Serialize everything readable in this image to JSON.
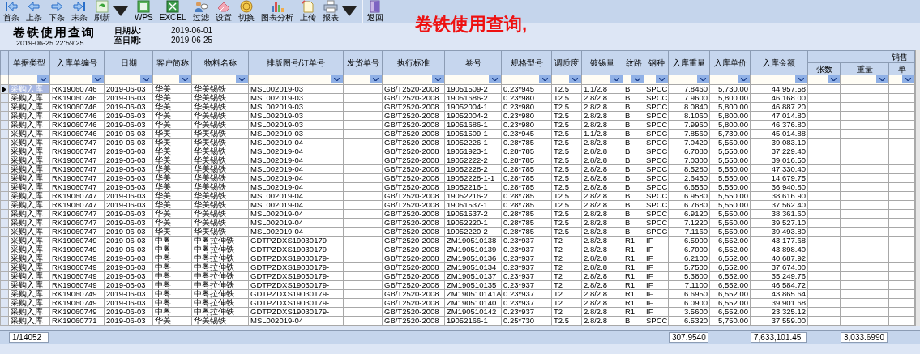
{
  "toolbar": [
    {
      "label": "首条",
      "dropdown": false,
      "separator_before": false
    },
    {
      "label": "上条",
      "dropdown": false,
      "separator_before": false
    },
    {
      "label": "下条",
      "dropdown": false,
      "separator_before": false
    },
    {
      "label": "末条",
      "dropdown": false,
      "separator_before": false
    },
    {
      "label": "刷新",
      "dropdown": true,
      "separator_before": false
    },
    {
      "label": "WPS",
      "dropdown": false,
      "separator_before": false
    },
    {
      "label": "EXCEL",
      "dropdown": false,
      "separator_before": false
    },
    {
      "label": "过滤",
      "dropdown": false,
      "separator_before": false
    },
    {
      "label": "设置",
      "dropdown": false,
      "separator_before": false
    },
    {
      "label": "切换",
      "dropdown": false,
      "separator_before": false
    },
    {
      "label": "图表分析",
      "dropdown": false,
      "separator_before": false
    },
    {
      "label": "上传",
      "dropdown": false,
      "separator_before": false
    },
    {
      "label": "报表",
      "dropdown": true,
      "separator_before": false
    },
    {
      "label": "返回",
      "dropdown": false,
      "separator_before": true
    }
  ],
  "overlay_annotation": "卷铁使用查询,",
  "header": {
    "title": "卷铁使用查询",
    "timestamp": "2019-06-25 22:59:25",
    "date_from_label": "日期从:",
    "date_from": "2019-06-01",
    "date_to_label": "至日期:",
    "date_to": "2019-06-25"
  },
  "table": {
    "columns": [
      "单据类型",
      "入库单编号",
      "日期",
      "客户简称",
      "物料名称",
      "排版图号/订单号",
      "发货单号",
      "执行标准",
      "卷号",
      "规格型号",
      "调质度",
      "镀锡量",
      "纹路",
      "钢种",
      "入库重量",
      "入库单价",
      "入库金额"
    ],
    "column_groups": [
      {
        "label": "销售",
        "columns": [
          "张数",
          "重量",
          "单"
        ]
      }
    ],
    "rows": [
      {
        "selected": true,
        "cells": [
          "采购入库",
          "RK19060746",
          "2019-06-03",
          "华美",
          "华美锡铁",
          "MSL002019-03",
          "",
          "GB/T2520-2008",
          "19051509-2",
          "0.23*945",
          "T2.5",
          "1.1/2.8",
          "B",
          "SPCC",
          "7.8460",
          "5,730.00",
          "44,957.58"
        ]
      },
      {
        "selected": false,
        "cells": [
          "采购入库",
          "RK19060746",
          "2019-06-03",
          "华美",
          "华美锡铁",
          "MSL002019-03",
          "",
          "GB/T2520-2008",
          "19051686-2",
          "0.23*980",
          "T2.5",
          "2.8/2.8",
          "B",
          "SPCC",
          "7.9600",
          "5,800.00",
          "46,168.00"
        ]
      },
      {
        "selected": false,
        "cells": [
          "采购入库",
          "RK19060746",
          "2019-06-03",
          "华美",
          "华美锡铁",
          "MSL002019-03",
          "",
          "GB/T2520-2008",
          "19052004-1",
          "0.23*980",
          "T2.5",
          "2.8/2.8",
          "B",
          "SPCC",
          "8.0840",
          "5,800.00",
          "46,887.20"
        ]
      },
      {
        "selected": false,
        "cells": [
          "采购入库",
          "RK19060746",
          "2019-06-03",
          "华美",
          "华美锡铁",
          "MSL002019-03",
          "",
          "GB/T2520-2008",
          "19052004-2",
          "0.23*980",
          "T2.5",
          "2.8/2.8",
          "B",
          "SPCC",
          "8.1060",
          "5,800.00",
          "47,014.80"
        ]
      },
      {
        "selected": false,
        "cells": [
          "采购入库",
          "RK19060746",
          "2019-06-03",
          "华美",
          "华美锡铁",
          "MSL002019-03",
          "",
          "GB/T2520-2008",
          "19051686-1",
          "0.23*980",
          "T2.5",
          "2.8/2.8",
          "B",
          "SPCC",
          "7.9960",
          "5,800.00",
          "46,376.80"
        ]
      },
      {
        "selected": false,
        "cells": [
          "采购入库",
          "RK19060746",
          "2019-06-03",
          "华美",
          "华美锡铁",
          "MSL002019-03",
          "",
          "GB/T2520-2008",
          "19051509-1",
          "0.23*945",
          "T2.5",
          "1.1/2.8",
          "B",
          "SPCC",
          "7.8560",
          "5,730.00",
          "45,014.88"
        ]
      },
      {
        "selected": false,
        "cells": [
          "采购入库",
          "RK19060747",
          "2019-06-03",
          "华美",
          "华美锡铁",
          "MSL002019-04",
          "",
          "GB/T2520-2008",
          "19052226-1",
          "0.28*785",
          "T2.5",
          "2.8/2.8",
          "B",
          "SPCC",
          "7.0420",
          "5,550.00",
          "39,083.10"
        ]
      },
      {
        "selected": false,
        "cells": [
          "采购入库",
          "RK19060747",
          "2019-06-03",
          "华美",
          "华美锡铁",
          "MSL002019-04",
          "",
          "GB/T2520-2008",
          "19051923-1",
          "0.28*785",
          "T2.5",
          "2.8/2.8",
          "B",
          "SPCC",
          "6.7080",
          "5,550.00",
          "37,229.40"
        ]
      },
      {
        "selected": false,
        "cells": [
          "采购入库",
          "RK19060747",
          "2019-06-03",
          "华美",
          "华美锡铁",
          "MSL002019-04",
          "",
          "GB/T2520-2008",
          "19052222-2",
          "0.28*785",
          "T2.5",
          "2.8/2.8",
          "B",
          "SPCC",
          "7.0300",
          "5,550.00",
          "39,016.50"
        ]
      },
      {
        "selected": false,
        "cells": [
          "采购入库",
          "RK19060747",
          "2019-06-03",
          "华美",
          "华美锡铁",
          "MSL002019-04",
          "",
          "GB/T2520-2008",
          "19052228-2",
          "0.28*785",
          "T2.5",
          "2.8/2.8",
          "B",
          "SPCC",
          "8.5280",
          "5,550.00",
          "47,330.40"
        ]
      },
      {
        "selected": false,
        "cells": [
          "采购入库",
          "RK19060747",
          "2019-06-03",
          "华美",
          "华美锡铁",
          "MSL002019-04",
          "",
          "GB/T2520-2008",
          "19052228-1-1",
          "0.28*785",
          "T2.5",
          "2.8/2.8",
          "B",
          "SPCC",
          "2.6450",
          "5,550.00",
          "14,679.75"
        ]
      },
      {
        "selected": false,
        "cells": [
          "采购入库",
          "RK19060747",
          "2019-06-03",
          "华美",
          "华美锡铁",
          "MSL002019-04",
          "",
          "GB/T2520-2008",
          "19052216-1",
          "0.28*785",
          "T2.5",
          "2.8/2.8",
          "B",
          "SPCC",
          "6.6560",
          "5,550.00",
          "36,940.80"
        ]
      },
      {
        "selected": false,
        "cells": [
          "采购入库",
          "RK19060747",
          "2019-06-03",
          "华美",
          "华美锡铁",
          "MSL002019-04",
          "",
          "GB/T2520-2008",
          "19052216-2",
          "0.28*785",
          "T2.5",
          "2.8/2.8",
          "B",
          "SPCC",
          "6.9580",
          "5,550.00",
          "38,616.90"
        ]
      },
      {
        "selected": false,
        "cells": [
          "采购入库",
          "RK19060747",
          "2019-06-03",
          "华美",
          "华美锡铁",
          "MSL002019-04",
          "",
          "GB/T2520-2008",
          "19051537-1",
          "0.28*785",
          "T2.5",
          "2.8/2.8",
          "B",
          "SPCC",
          "6.7680",
          "5,550.00",
          "37,562.40"
        ]
      },
      {
        "selected": false,
        "cells": [
          "采购入库",
          "RK19060747",
          "2019-06-03",
          "华美",
          "华美锡铁",
          "MSL002019-04",
          "",
          "GB/T2520-2008",
          "19051537-2",
          "0.28*785",
          "T2.5",
          "2.8/2.8",
          "B",
          "SPCC",
          "6.9120",
          "5,550.00",
          "38,361.60"
        ]
      },
      {
        "selected": false,
        "cells": [
          "采购入库",
          "RK19060747",
          "2019-06-03",
          "华美",
          "华美锡铁",
          "MSL002019-04",
          "",
          "GB/T2520-2008",
          "19052220-1",
          "0.28*785",
          "T2.5",
          "2.8/2.8",
          "B",
          "SPCC",
          "7.1220",
          "5,550.00",
          "39,527.10"
        ]
      },
      {
        "selected": false,
        "cells": [
          "采购入库",
          "RK19060747",
          "2019-06-03",
          "华美",
          "华美锡铁",
          "MSL002019-04",
          "",
          "GB/T2520-2008",
          "19052220-2",
          "0.28*785",
          "T2.5",
          "2.8/2.8",
          "B",
          "SPCC",
          "7.1160",
          "5,550.00",
          "39,493.80"
        ]
      },
      {
        "selected": false,
        "cells": [
          "采购入库",
          "RK19060749",
          "2019-06-03",
          "中粤",
          "中粤拉伸铁",
          "GDTPZDXS19030179-",
          "",
          "GB/T2520-2008",
          "ZM190510138",
          "0.23*937",
          "T2",
          "2.8/2.8",
          "R1",
          "IF",
          "6.5900",
          "6,552.00",
          "43,177.68"
        ]
      },
      {
        "selected": false,
        "cells": [
          "采购入库",
          "RK19060749",
          "2019-06-03",
          "中粤",
          "中粤拉伸铁",
          "GDTPZDXS19030179-",
          "",
          "GB/T2520-2008",
          "ZM190510139",
          "0.23*937",
          "T2",
          "2.8/2.8",
          "R1",
          "IF",
          "6.7000",
          "6,552.00",
          "43,898.40"
        ]
      },
      {
        "selected": false,
        "cells": [
          "采购入库",
          "RK19060749",
          "2019-06-03",
          "中粤",
          "中粤拉伸铁",
          "GDTPZDXS19030179-",
          "",
          "GB/T2520-2008",
          "ZM190510136",
          "0.23*937",
          "T2",
          "2.8/2.8",
          "R1",
          "IF",
          "6.2100",
          "6,552.00",
          "40,687.92"
        ]
      },
      {
        "selected": false,
        "cells": [
          "采购入库",
          "RK19060749",
          "2019-06-03",
          "中粤",
          "中粤拉伸铁",
          "GDTPZDXS19030179-",
          "",
          "GB/T2520-2008",
          "ZM190510134",
          "0.23*937",
          "T2",
          "2.8/2.8",
          "R1",
          "IF",
          "5.7500",
          "6,552.00",
          "37,674.00"
        ]
      },
      {
        "selected": false,
        "cells": [
          "采购入库",
          "RK19060749",
          "2019-06-03",
          "中粤",
          "中粤拉伸铁",
          "GDTPZDXS19030179-",
          "",
          "GB/T2520-2008",
          "ZM190510137",
          "0.23*937",
          "T2",
          "2.8/2.8",
          "R1",
          "IF",
          "5.3800",
          "6,552.00",
          "35,249.76"
        ]
      },
      {
        "selected": false,
        "cells": [
          "采购入库",
          "RK19060749",
          "2019-06-03",
          "中粤",
          "中粤拉伸铁",
          "GDTPZDXS19030179-",
          "",
          "GB/T2520-2008",
          "ZM190510135",
          "0.23*937",
          "T2",
          "2.8/2.8",
          "R1",
          "IF",
          "7.1100",
          "6,552.00",
          "46,584.72"
        ]
      },
      {
        "selected": false,
        "cells": [
          "采购入库",
          "RK19060749",
          "2019-06-03",
          "中粤",
          "中粤拉伸铁",
          "GDTPZDXS19030179-",
          "",
          "GB/T2520-2008",
          "ZM190510141A",
          "0.23*937",
          "T2",
          "2.8/2.8",
          "R1",
          "IF",
          "6.6950",
          "6,552.00",
          "43,865.64"
        ]
      },
      {
        "selected": false,
        "cells": [
          "采购入库",
          "RK19060749",
          "2019-06-03",
          "中粤",
          "中粤拉伸铁",
          "GDTPZDXS19030179-",
          "",
          "GB/T2520-2008",
          "ZM190510140",
          "0.23*937",
          "T2",
          "2.8/2.8",
          "R1",
          "IF",
          "6.0900",
          "6,552.00",
          "39,901.68"
        ]
      },
      {
        "selected": false,
        "cells": [
          "采购入库",
          "RK19060749",
          "2019-06-03",
          "中粤",
          "中粤拉伸铁",
          "GDTPZDXS19030179-",
          "",
          "GB/T2520-2008",
          "ZM190510142",
          "0.23*937",
          "T2",
          "2.8/2.8",
          "R1",
          "IF",
          "3.5600",
          "6,552.00",
          "23,325.12"
        ]
      },
      {
        "selected": false,
        "cells": [
          "采购入库",
          "RK19060771",
          "2019-06-03",
          "华美",
          "华美锡铁",
          "MSL002019-04",
          "",
          "GB/T2520-2008",
          "19052166-1",
          "0.25*730",
          "T2.5",
          "2.8/2.8",
          "B",
          "SPCC",
          "6.5320",
          "5,750.00",
          "37,559.00"
        ]
      }
    ]
  },
  "footer": {
    "record_position": "1/14052",
    "inbound_weight_total": "307.9540",
    "inbound_amount_total": "7,633,101.45",
    "sales_weight_total": "3,033.6990"
  }
}
